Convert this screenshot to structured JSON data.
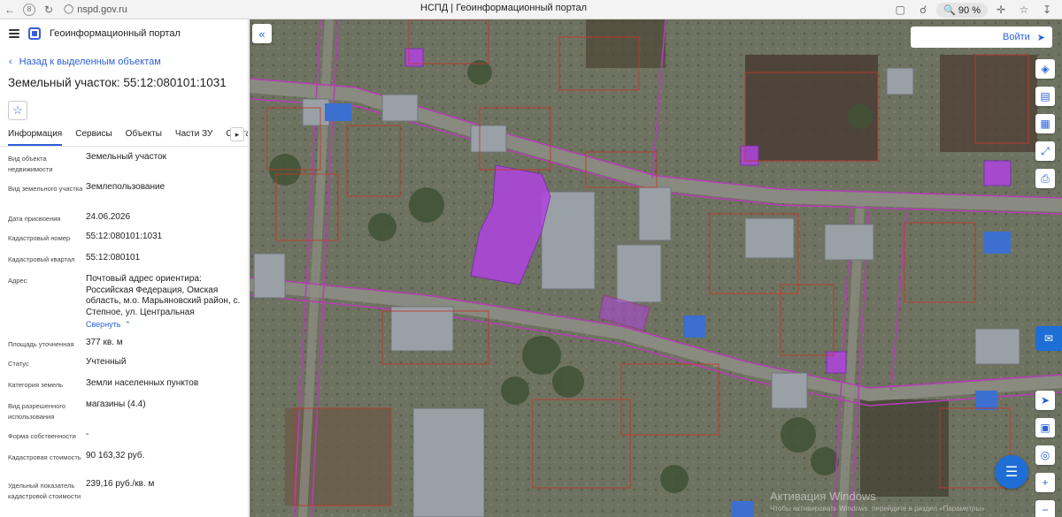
{
  "browser": {
    "url": "nspd.gov.ru",
    "title": "НСПД | Геоинформационный портал",
    "zoom": "90 %"
  },
  "sidebar": {
    "portal_title": "Геоинформационный портал",
    "back_link": "Назад к выделенным объектам",
    "object_title": "Земельный участок: 55:12:080101:1031",
    "tabs": [
      "Информация",
      "Сервисы",
      "Объекты",
      "Части ЗУ",
      "Состав"
    ],
    "properties": [
      {
        "label": "Вид объекта недвижимости",
        "value": "Земельный участок"
      },
      {
        "label": "Вид земельного участка",
        "value": "Землепользование"
      },
      {
        "label": "Дата присвоения",
        "value": "24.06.2026"
      },
      {
        "label": "Кадастровый номер",
        "value": "55:12:080101:1031"
      },
      {
        "label": "Кадастровый квартал",
        "value": "55:12:080101"
      },
      {
        "label": "Адрес",
        "value": "Почтовый адрес ориентира: Российская Федерация, Омская область, м.о. Марьяновский район, с. Степное, ул. Центральная"
      },
      {
        "label": "Площадь уточненная",
        "value": "377 кв. м"
      },
      {
        "label": "Статус",
        "value": "Учтенный"
      },
      {
        "label": "Категория земель",
        "value": "Земли населенных пунктов"
      },
      {
        "label": "Вид разрешенного использования",
        "value": "магазины (4.4)"
      },
      {
        "label": "Форма собственности",
        "value": "-"
      },
      {
        "label": "Кадастровая стоимость",
        "value": "90 163,32 руб."
      },
      {
        "label": "Удельный показатель кадастровой стоимости",
        "value": "239,16 руб./кв. м"
      }
    ],
    "collapse_label": "Свернуть"
  },
  "map": {
    "login_label": "Войти",
    "watermark_title": "Активация Windows",
    "watermark_sub": "Чтобы активировать Windows, перейдите в раздел «Параметры»."
  },
  "colors": {
    "accent": "#2b5fd9",
    "parcel_border": "#c0392b",
    "selected_fill": "#b044e0",
    "road_line": "#b53fb5"
  }
}
